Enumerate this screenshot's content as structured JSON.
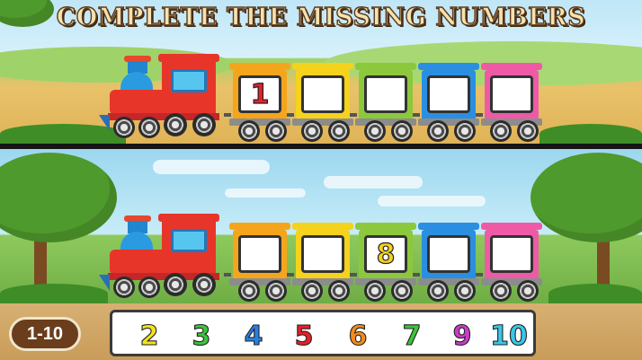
{
  "title": "COMPLETE THE MISSING NUMBERS",
  "range_label": "1-10",
  "colors": {
    "wagon_orange": "#f5a51c",
    "wagon_yellow": "#f5d21c",
    "wagon_green": "#8cc83c",
    "wagon_blue": "#2a8fe0",
    "wagon_pink": "#ef5aa7"
  },
  "train_top": {
    "wagons": [
      {
        "color": "#f5a51c",
        "value": "1",
        "text_color": "#e8202a"
      },
      {
        "color": "#f5d21c",
        "value": ""
      },
      {
        "color": "#8cc83c",
        "value": ""
      },
      {
        "color": "#2a8fe0",
        "value": ""
      },
      {
        "color": "#ef5aa7",
        "value": ""
      }
    ]
  },
  "train_bottom": {
    "wagons": [
      {
        "color": "#f5a51c",
        "value": ""
      },
      {
        "color": "#f5d21c",
        "value": ""
      },
      {
        "color": "#8cc83c",
        "value": "8",
        "text_color": "#f5d21c"
      },
      {
        "color": "#2a8fe0",
        "value": ""
      },
      {
        "color": "#ef5aa7",
        "value": ""
      }
    ]
  },
  "number_tiles": [
    {
      "value": "2",
      "color": "#f5e21c"
    },
    {
      "value": "3",
      "color": "#3cc43c"
    },
    {
      "value": "4",
      "color": "#2a7fe0"
    },
    {
      "value": "5",
      "color": "#e8202a"
    },
    {
      "value": "6",
      "color": "#f58a1c"
    },
    {
      "value": "7",
      "color": "#3cc43c"
    },
    {
      "value": "9",
      "color": "#c83cc8"
    },
    {
      "value": "10",
      "color": "#38c8e8"
    }
  ]
}
